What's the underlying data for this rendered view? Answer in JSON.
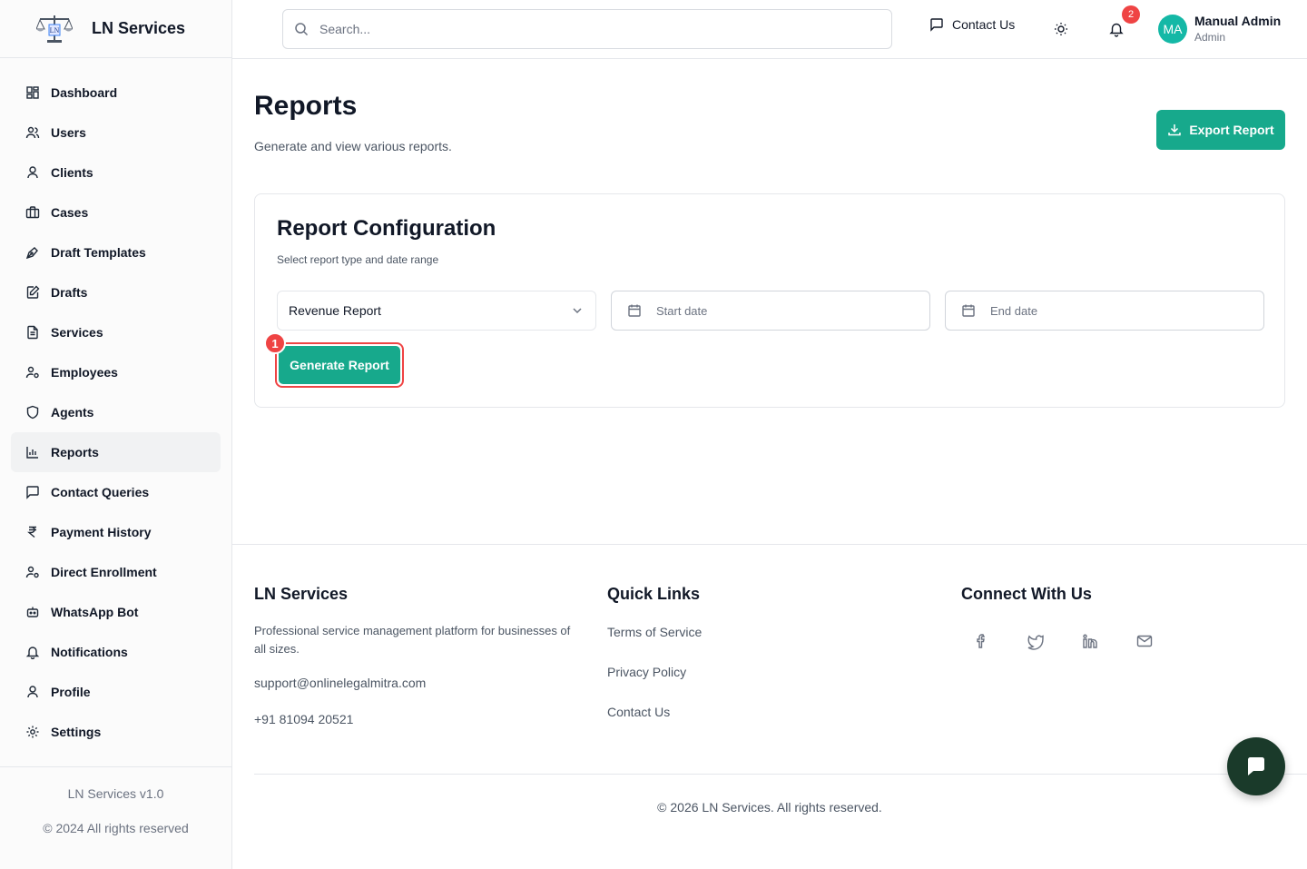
{
  "brand": {
    "name": "LN Services"
  },
  "sidebar": {
    "items": [
      {
        "label": "Dashboard",
        "icon": "dashboard-icon"
      },
      {
        "label": "Users",
        "icon": "users-icon"
      },
      {
        "label": "Clients",
        "icon": "user-icon"
      },
      {
        "label": "Cases",
        "icon": "briefcase-icon"
      },
      {
        "label": "Draft Templates",
        "icon": "pen-tool-icon"
      },
      {
        "label": "Drafts",
        "icon": "edit-file-icon"
      },
      {
        "label": "Services",
        "icon": "file-text-icon"
      },
      {
        "label": "Employees",
        "icon": "user-cog-icon"
      },
      {
        "label": "Agents",
        "icon": "shield-icon"
      },
      {
        "label": "Reports",
        "icon": "bar-chart-icon",
        "active": true
      },
      {
        "label": "Contact Queries",
        "icon": "message-square-icon"
      },
      {
        "label": "Payment History",
        "icon": "rupee-icon"
      },
      {
        "label": "Direct Enrollment",
        "icon": "user-cog-icon"
      },
      {
        "label": "WhatsApp Bot",
        "icon": "bot-icon"
      },
      {
        "label": "Notifications",
        "icon": "bell-icon"
      },
      {
        "label": "Profile",
        "icon": "user-icon"
      },
      {
        "label": "Settings",
        "icon": "gear-icon"
      }
    ],
    "version": "LN Services v1.0",
    "copyright": "© 2024 All rights reserved"
  },
  "header": {
    "search_placeholder": "Search...",
    "contact_label": "Contact Us",
    "notification_count": "2",
    "avatar_initials": "MA",
    "user_name": "Manual Admin",
    "user_role": "Admin"
  },
  "page": {
    "title": "Reports",
    "subtitle": "Generate and view various reports.",
    "export_label": "Export Report"
  },
  "config": {
    "title": "Report Configuration",
    "subtitle": "Select report type and date range",
    "report_type": "Revenue Report",
    "start_placeholder": "Start date",
    "end_placeholder": "End date",
    "generate_label": "Generate Report",
    "step_marker": "1"
  },
  "footer": {
    "brand_title": "LN Services",
    "description": "Professional service management platform for businesses of all sizes.",
    "email": "support@onlinelegalmitra.com",
    "phone": "+91 81094 20521",
    "quick_links_title": "Quick Links",
    "links": [
      "Terms of Service",
      "Privacy Policy",
      "Contact Us"
    ],
    "connect_title": "Connect With Us",
    "social": [
      "facebook-icon",
      "twitter-icon",
      "linkedin-icon",
      "mail-icon"
    ],
    "copyright": "© 2026 LN Services. All rights reserved."
  },
  "colors": {
    "accent": "#17a98c",
    "badge": "#ef4444",
    "chat_fab": "#1a3a2a"
  }
}
